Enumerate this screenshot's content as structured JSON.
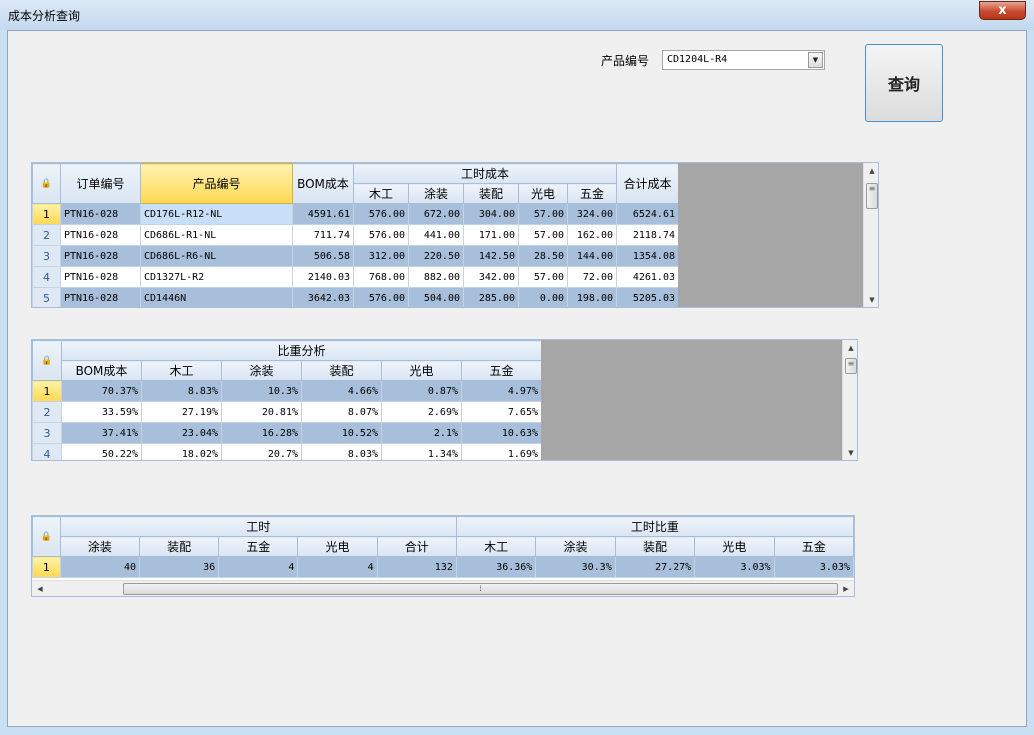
{
  "window": {
    "title": "成本分析查询",
    "close_label": "x"
  },
  "filter": {
    "product_label": "产品编号",
    "product_value": "CD1204L-R4",
    "query_label": "查询"
  },
  "grid1": {
    "header_top": {
      "order_no": "订单编号",
      "product_no": "产品编号",
      "bom_cost": "BOM成本",
      "labor_cost": "工时成本",
      "total_cost": "合计成本"
    },
    "labor_sub": [
      "木工",
      "涂装",
      "装配",
      "光电",
      "五金"
    ],
    "rows": [
      {
        "no": "1",
        "order": "PTN16-028",
        "product": "CD176L-R12-NL",
        "bom": "4591.61",
        "wood": "576.00",
        "paint": "672.00",
        "assy": "304.00",
        "opto": "57.00",
        "hw": "324.00",
        "total": "6524.61"
      },
      {
        "no": "2",
        "order": "PTN16-028",
        "product": "CD686L-R1-NL",
        "bom": "711.74",
        "wood": "576.00",
        "paint": "441.00",
        "assy": "171.00",
        "opto": "57.00",
        "hw": "162.00",
        "total": "2118.74"
      },
      {
        "no": "3",
        "order": "PTN16-028",
        "product": "CD686L-R6-NL",
        "bom": "506.58",
        "wood": "312.00",
        "paint": "220.50",
        "assy": "142.50",
        "opto": "28.50",
        "hw": "144.00",
        "total": "1354.08"
      },
      {
        "no": "4",
        "order": "PTN16-028",
        "product": "CD1327L-R2",
        "bom": "2140.03",
        "wood": "768.00",
        "paint": "882.00",
        "assy": "342.00",
        "opto": "57.00",
        "hw": "72.00",
        "total": "4261.03"
      },
      {
        "no": "5",
        "order": "PTN16-028",
        "product": "CD1446N",
        "bom": "3642.03",
        "wood": "576.00",
        "paint": "504.00",
        "assy": "285.00",
        "opto": "0.00",
        "hw": "198.00",
        "total": "5205.03"
      }
    ]
  },
  "grid2": {
    "band": "比重分析",
    "columns": [
      "BOM成本",
      "木工",
      "涂装",
      "装配",
      "光电",
      "五金"
    ],
    "rows": [
      {
        "no": "1",
        "vals": [
          "70.37%",
          "8.83%",
          "10.3%",
          "4.66%",
          "0.87%",
          "4.97%"
        ]
      },
      {
        "no": "2",
        "vals": [
          "33.59%",
          "27.19%",
          "20.81%",
          "8.07%",
          "2.69%",
          "7.65%"
        ]
      },
      {
        "no": "3",
        "vals": [
          "37.41%",
          "23.04%",
          "16.28%",
          "10.52%",
          "2.1%",
          "10.63%"
        ]
      },
      {
        "no": "4",
        "vals": [
          "50.22%",
          "18.02%",
          "20.7%",
          "8.03%",
          "1.34%",
          "1.69%"
        ]
      }
    ]
  },
  "grid3": {
    "band_hours": "工时",
    "band_ratio": "工时比重",
    "columns": [
      "涂装",
      "装配",
      "五金",
      "光电",
      "合计",
      "木工",
      "涂装",
      "装配",
      "光电",
      "五金"
    ],
    "rows": [
      {
        "no": "1",
        "vals": [
          "40",
          "36",
          "4",
          "4",
          "132",
          "36.36%",
          "30.3%",
          "27.27%",
          "3.03%",
          "3.03%"
        ]
      }
    ]
  },
  "icons": {
    "lock": "lock-icon",
    "dropdown": "chevron-down-icon",
    "up": "arrow-up-icon",
    "down": "arrow-down-icon",
    "left": "arrow-left-icon",
    "right": "arrow-right-icon"
  }
}
